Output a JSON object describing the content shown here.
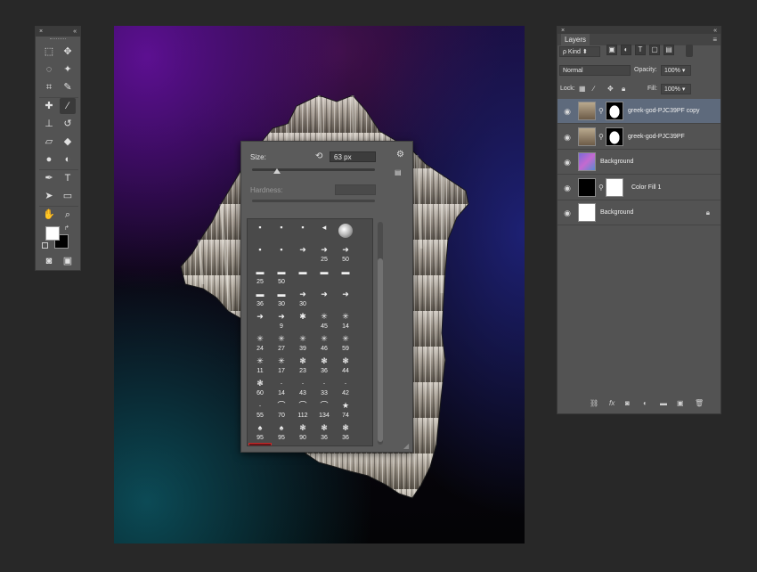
{
  "tools_panel": {
    "close": "×",
    "collapse": "«",
    "tools": [
      {
        "name": "marquee",
        "glyph": "⬚"
      },
      {
        "name": "move",
        "glyph": "✥"
      },
      {
        "name": "lasso",
        "glyph": "◌"
      },
      {
        "name": "magic-wand",
        "glyph": "✦"
      },
      {
        "name": "crop",
        "glyph": "⌗"
      },
      {
        "name": "eyedropper",
        "glyph": "✎"
      },
      {
        "name": "healing",
        "glyph": "✚"
      },
      {
        "name": "brush",
        "glyph": "∕"
      },
      {
        "name": "clone-stamp",
        "glyph": "⊥"
      },
      {
        "name": "history-brush",
        "glyph": "↺"
      },
      {
        "name": "eraser",
        "glyph": "▱"
      },
      {
        "name": "paint-bucket",
        "glyph": "◆"
      },
      {
        "name": "blur",
        "glyph": "●"
      },
      {
        "name": "dodge",
        "glyph": "◐"
      },
      {
        "name": "pen",
        "glyph": "✒"
      },
      {
        "name": "type",
        "glyph": "T"
      },
      {
        "name": "path-selection",
        "glyph": "➤"
      },
      {
        "name": "shape",
        "glyph": "▭"
      },
      {
        "name": "hand",
        "glyph": "✋"
      },
      {
        "name": "zoom",
        "glyph": "⌕"
      },
      {
        "name": "quick-mask",
        "glyph": "◙"
      },
      {
        "name": "screen-mode",
        "glyph": "▣"
      }
    ]
  },
  "brush_picker": {
    "size_label": "Size:",
    "size_value": "63 px",
    "hardness_label": "Hardness:",
    "size_fraction": 0.2,
    "presets": [
      {
        "g": "▪",
        "n": ""
      },
      {
        "g": "▪",
        "n": ""
      },
      {
        "g": "▪",
        "n": ""
      },
      {
        "g": "◂",
        "n": ""
      },
      {
        "g": "",
        "n": "",
        "type": "big"
      },
      {
        "g": "▪",
        "n": ""
      },
      {
        "g": "▪",
        "n": ""
      },
      {
        "g": "➜",
        "n": ""
      },
      {
        "g": "➜",
        "n": "25"
      },
      {
        "g": "➜",
        "n": "50"
      },
      {
        "g": "▬",
        "n": "25"
      },
      {
        "g": "▬",
        "n": "50"
      },
      {
        "g": "▬",
        "n": ""
      },
      {
        "g": "▬",
        "n": ""
      },
      {
        "g": "▬",
        "n": ""
      },
      {
        "g": "▬",
        "n": "36"
      },
      {
        "g": "▬",
        "n": "30"
      },
      {
        "g": "➜",
        "n": "30"
      },
      {
        "g": "➜",
        "n": ""
      },
      {
        "g": "➜",
        "n": ""
      },
      {
        "g": "➜",
        "n": ""
      },
      {
        "g": "➜",
        "n": "9"
      },
      {
        "g": "✱",
        "n": ""
      },
      {
        "g": "✳",
        "n": "45"
      },
      {
        "g": "✳",
        "n": "14"
      },
      {
        "g": "✳",
        "n": "24"
      },
      {
        "g": "✳",
        "n": "27"
      },
      {
        "g": "✳",
        "n": "39"
      },
      {
        "g": "✳",
        "n": "46"
      },
      {
        "g": "✳",
        "n": "59"
      },
      {
        "g": "✳",
        "n": "11"
      },
      {
        "g": "✳",
        "n": "17"
      },
      {
        "g": "❃",
        "n": "23"
      },
      {
        "g": "❃",
        "n": "36"
      },
      {
        "g": "❃",
        "n": "44"
      },
      {
        "g": "❃",
        "n": "60"
      },
      {
        "g": "·",
        "n": "14"
      },
      {
        "g": "·",
        "n": "43"
      },
      {
        "g": "·",
        "n": "33"
      },
      {
        "g": "·",
        "n": "42"
      },
      {
        "g": "·",
        "n": "55"
      },
      {
        "g": "⌒",
        "n": "70"
      },
      {
        "g": "⌒",
        "n": "112"
      },
      {
        "g": "⌒",
        "n": "134"
      },
      {
        "g": "★",
        "n": "74"
      },
      {
        "g": "♠",
        "n": "95"
      },
      {
        "g": "♠",
        "n": "95"
      },
      {
        "g": "❃",
        "n": "90"
      },
      {
        "g": "❃",
        "n": "36"
      },
      {
        "g": "❃",
        "n": "36"
      },
      {
        "g": "❃",
        "n": "33",
        "sel": true
      },
      {
        "g": "❃",
        "n": "63"
      },
      {
        "g": "❃",
        "n": "66"
      },
      {
        "g": "❃",
        "n": "39"
      },
      {
        "g": "❃",
        "n": "63"
      },
      {
        "g": "❃",
        "n": "11"
      },
      {
        "g": "❃",
        "n": "48"
      },
      {
        "g": "❃",
        "n": "32"
      },
      {
        "g": "",
        "n": "55",
        "type": "dot"
      },
      {
        "g": "❃",
        "n": "100"
      }
    ]
  },
  "layers_panel": {
    "title": "Layers",
    "close": "×",
    "collapse": "«",
    "filter": "ρ Kind",
    "blend_mode": "Normal",
    "opacity_label": "Opacity:",
    "opacity_value": "100%",
    "lock_label": "Lock:",
    "fill_label": "Fill:",
    "fill_value": "100%",
    "layers": [
      {
        "name": "greek-god-PJC39PF copy",
        "thumb": "photo",
        "mask": true,
        "selected": true
      },
      {
        "name": "greek-god-PJC39PF",
        "thumb": "photo",
        "mask": true
      },
      {
        "name": "Background",
        "thumb": "checker"
      },
      {
        "name": "Color Fill 1",
        "thumb": "black",
        "mask": true
      },
      {
        "name": "Background",
        "thumb": "white",
        "locked": true
      }
    ],
    "footer_icons": [
      "link-icon",
      "fx-icon",
      "mask-icon",
      "adjustment-icon",
      "group-icon",
      "new-layer-icon",
      "trash-icon"
    ]
  },
  "colors": {
    "bg": "#282828",
    "panel": "#535353",
    "selected_row": "#5e6a7c",
    "selected_brush": "#c62a2a"
  }
}
